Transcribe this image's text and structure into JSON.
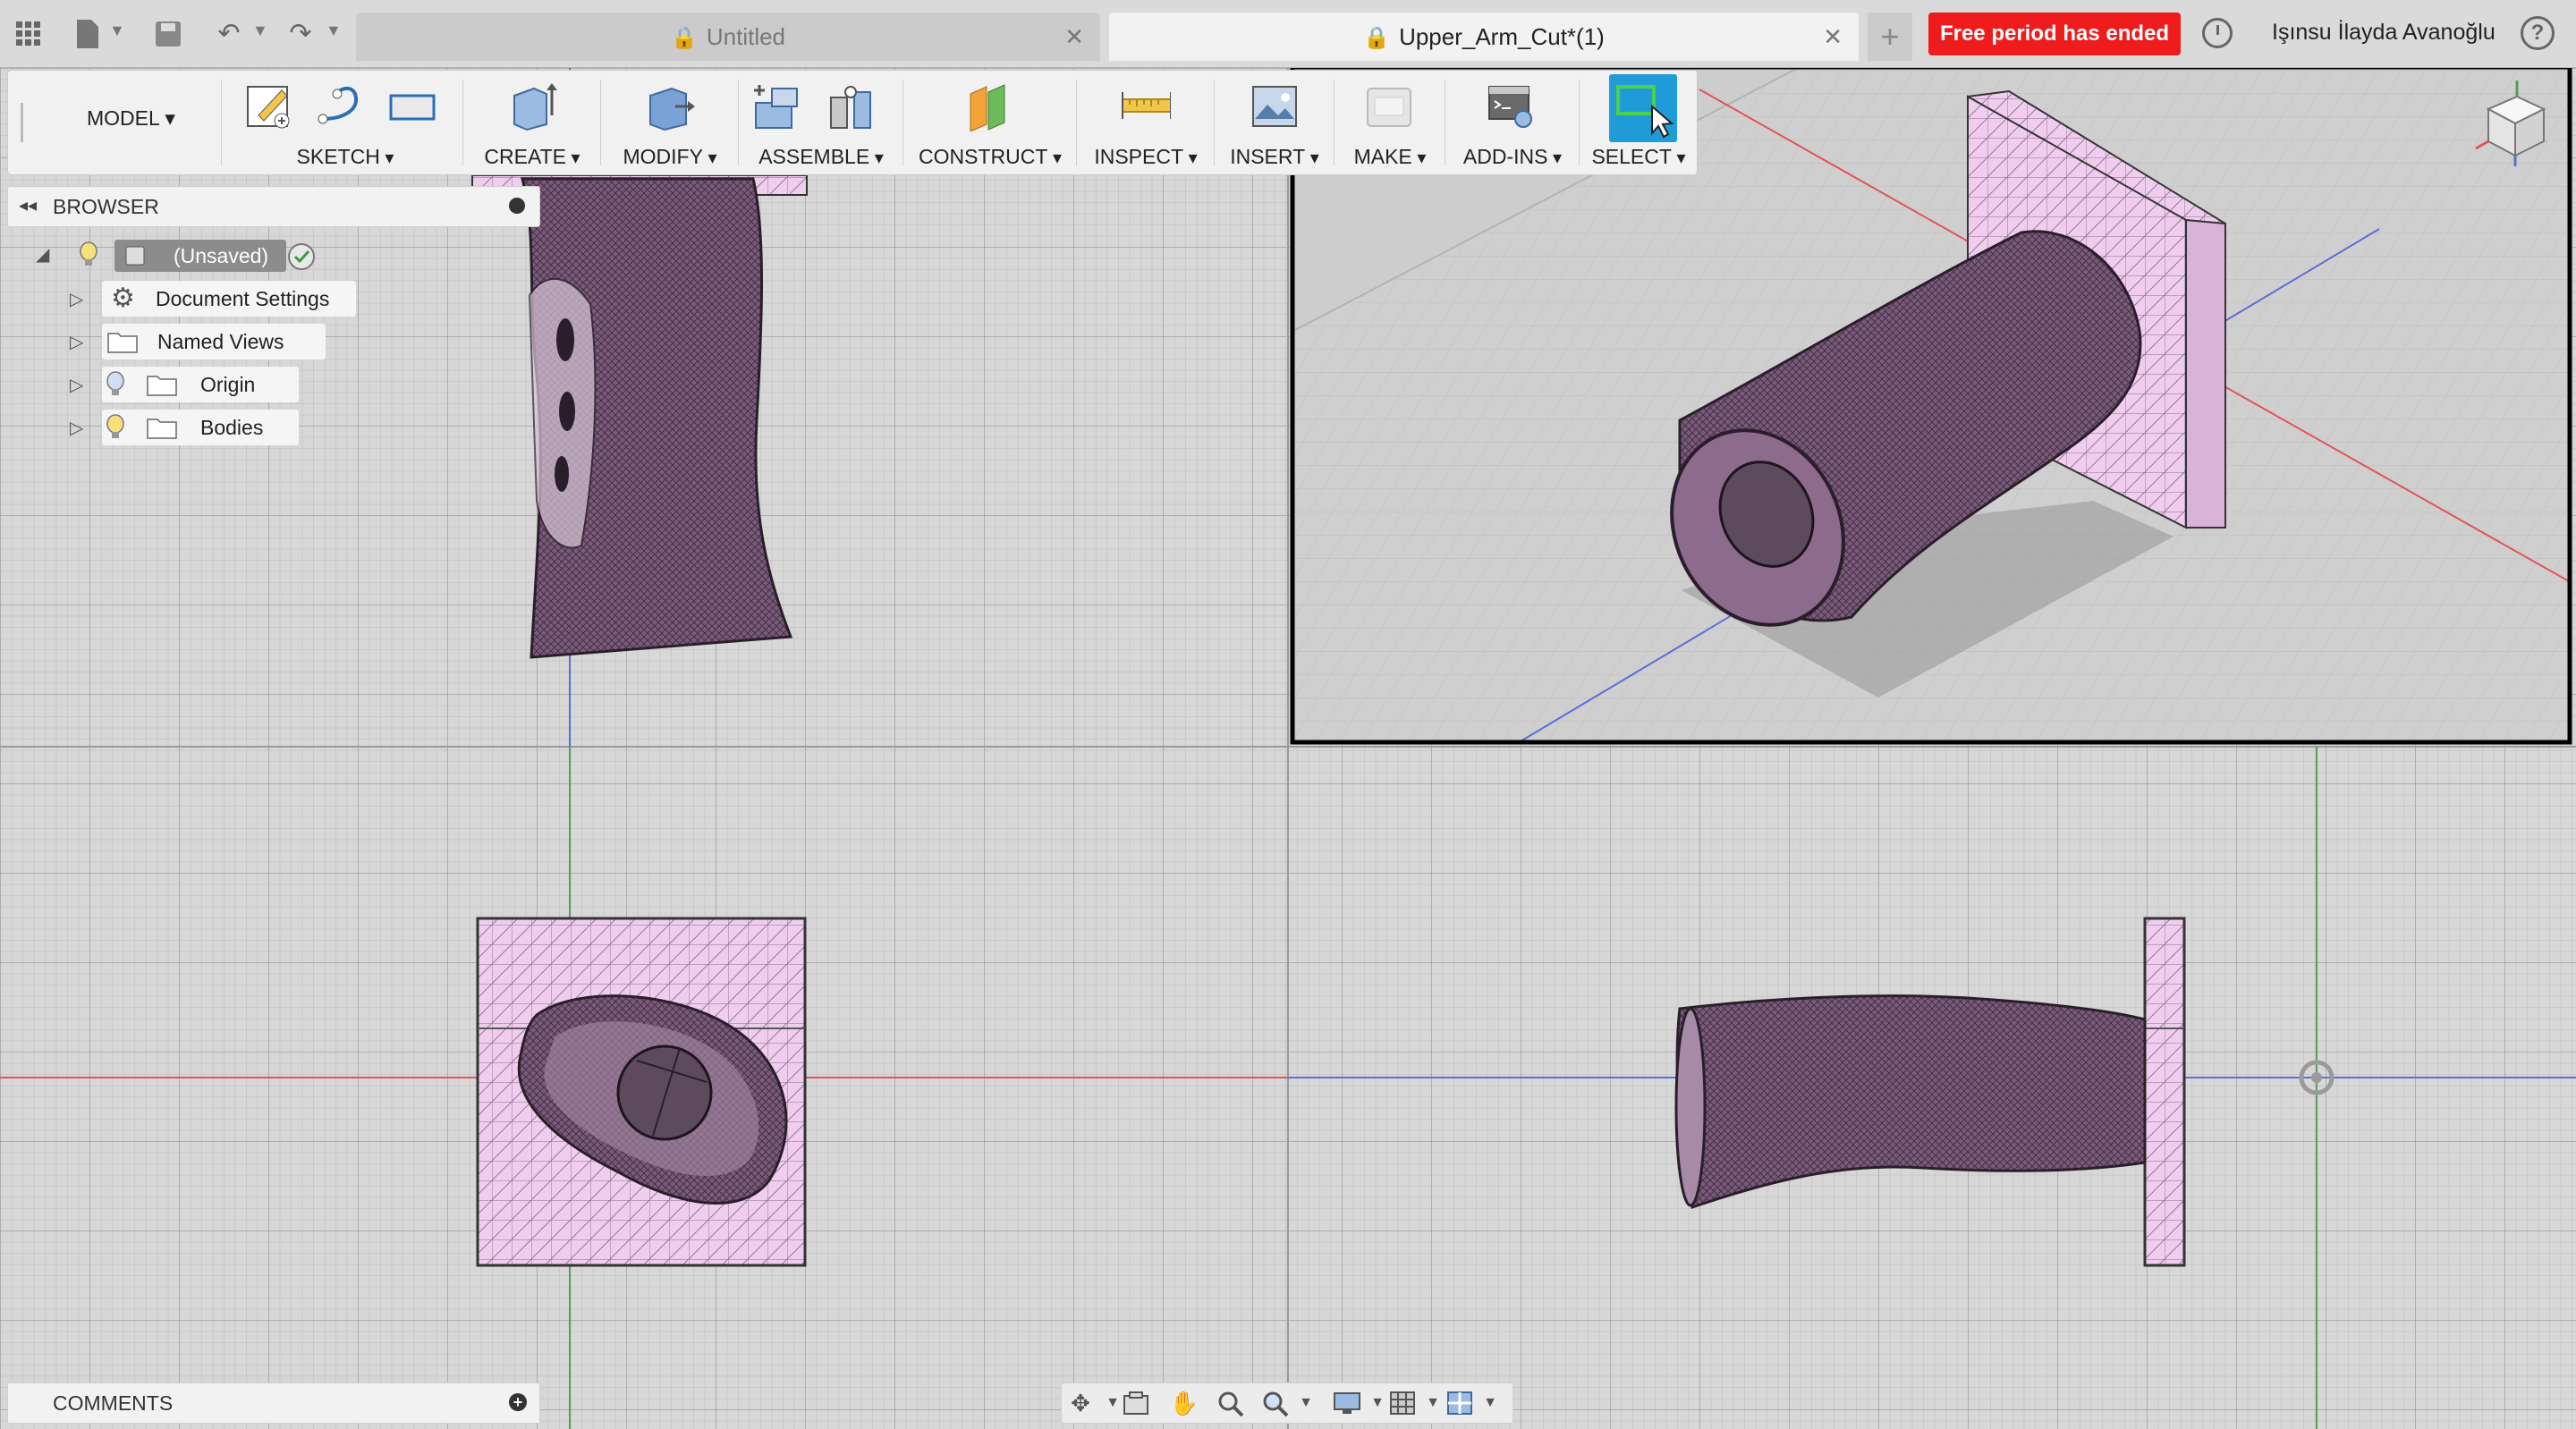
{
  "topbar": {
    "tabs": [
      {
        "label": "Untitled",
        "active": false
      },
      {
        "label": "Upper_Arm_Cut*(1)",
        "active": true
      }
    ],
    "badge": "Free period has ended",
    "username": "Işınsu İlayda Avanoğlu",
    "help": "?"
  },
  "toolbar": {
    "workspace": "MODEL",
    "groups": [
      {
        "label": "SKETCH",
        "icons": [
          "create-sketch-icon",
          "arc-icon",
          "rectangle-icon"
        ]
      },
      {
        "label": "CREATE",
        "icons": [
          "extrude-icon"
        ]
      },
      {
        "label": "MODIFY",
        "icons": [
          "press-pull-icon"
        ]
      },
      {
        "label": "ASSEMBLE",
        "icons": [
          "new-component-icon",
          "joint-icon"
        ]
      },
      {
        "label": "CONSTRUCT",
        "icons": [
          "offset-plane-icon"
        ]
      },
      {
        "label": "INSPECT",
        "icons": [
          "measure-icon"
        ]
      },
      {
        "label": "INSERT",
        "icons": [
          "insert-image-icon"
        ]
      },
      {
        "label": "MAKE",
        "icons": [
          "3d-print-icon"
        ]
      },
      {
        "label": "ADD-INS",
        "icons": [
          "scripts-icon"
        ]
      },
      {
        "label": "SELECT",
        "icons": [
          "select-icon"
        ]
      }
    ]
  },
  "browser": {
    "title": "BROWSER",
    "root": "(Unsaved)",
    "items": [
      {
        "label": "Document Settings",
        "icon": "gear-icon"
      },
      {
        "label": "Named Views",
        "icon": "folder-icon"
      },
      {
        "label": "Origin",
        "icon": "folder-icon"
      },
      {
        "label": "Bodies",
        "icon": "folder-icon"
      }
    ]
  },
  "comments": {
    "title": "COMMENTS"
  },
  "colors": {
    "accent_select": "#1f9bd8",
    "badge_red": "#ee1c1c",
    "mesh_fill": "#7d5d7d",
    "plate_fill": "#efc9ee",
    "x_axis": "#e05555",
    "y_axis": "#5b9c5b",
    "z_axis": "#5a6fd6"
  }
}
